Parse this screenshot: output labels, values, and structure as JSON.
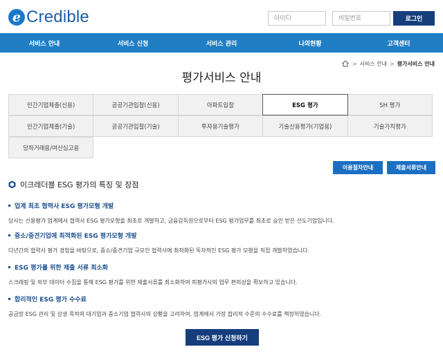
{
  "brand": {
    "logo_mark": "e",
    "logo_text": "Credible"
  },
  "login": {
    "id_placeholder": "아이디",
    "pw_placeholder": "비밀번호",
    "button": "로그인"
  },
  "nav": {
    "items": [
      "서비스 안내",
      "서비스 신청",
      "서비스 관리",
      "나의현황",
      "고객센터"
    ]
  },
  "breadcrumb": {
    "icon": "home-icon",
    "level1": "서비스 안내",
    "current": "평가서비스 안내",
    "separator": ">"
  },
  "page_title": "평가서비스 안내",
  "tabs": {
    "rows": [
      [
        "민간기업제출(신용)",
        "공공기관입찰(신용)",
        "아파트입찰",
        "ESG 평가",
        "SH 평가"
      ],
      [
        "민간기업제출(기술)",
        "공공기관입찰(기술)",
        "투자용기술평가",
        "기술신용평가(기업용)",
        "기술가치평가"
      ],
      [
        "당좌거래용/여신심고용"
      ]
    ],
    "active": "ESG 평가"
  },
  "actions": {
    "process": "이용절차안내",
    "documents": "제출서류안내"
  },
  "section": {
    "title": "이크레더블 ESG 평가의 특징 및 장점",
    "features": [
      {
        "title": "업계 최초 협력사 ESG 평가모형 개발",
        "desc": "당사는 신용평가 업계에서 협력사 ESG 평가모형을 최초로 개발하고, 금융감독원으로부터 ESG 평가업무를 최초로 승인 받은 선도기업입니다."
      },
      {
        "title": "중소/중견기업에 최적화된 ESG 평가모형 개발",
        "desc": "다년간의 협력사 평가 경험을 바탕으로, 중소/중견기업 규모인 협력사에 최적화된 독자적인 ESG 평가 모형을 직접 개발하였습니다."
      },
      {
        "title": "ESG 평가를 위한 제출 서류 최소화",
        "desc": "스크래핑 및 외부 데이터 수집을 통해 ESG 평가를 위한 제출서류를 최소화하여 피평가사의 업무 편의성을 확보하고 있습니다."
      },
      {
        "title": "합리적인 ESG 평가 수수료",
        "desc": "공급망 ESG 관리 및 상생 목적의 대기업과 중소기업 협력사의 상황을 고려하여, 업계에서 가장 합리적 수준의 수수료를 책정하였습니다."
      }
    ]
  },
  "apply_button": "ESG 평가 신청하기",
  "colors": {
    "nav": "#1f7ec4",
    "dark_button": "#163e7d",
    "action_button": "#1b6fc3",
    "feature_title": "#1b4f8f"
  }
}
